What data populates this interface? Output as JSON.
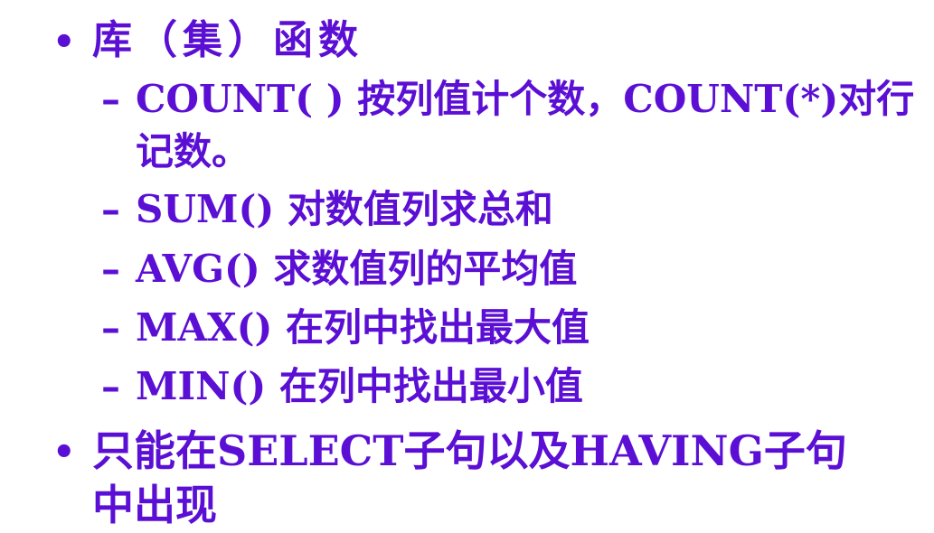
{
  "slide": {
    "items": [
      {
        "marker": "•",
        "text": "库（集）函数",
        "subitems": [
          {
            "marker": "–",
            "text": "COUNT( ) 按列值计个数，COUNT(*)对行",
            "continuation": "记数。"
          },
          {
            "marker": "–",
            "text": "SUM() 对数值列求总和"
          },
          {
            "marker": "–",
            "text": "AVG() 求数值列的平均值"
          },
          {
            "marker": "–",
            "text": "MAX() 在列中找出最大值"
          },
          {
            "marker": "–",
            "text": "MIN()  在列中找出最小值"
          }
        ]
      },
      {
        "marker": "•",
        "text": "只能在SELECT子句以及HAVING子句",
        "continuation": "中出现"
      }
    ]
  },
  "colors": {
    "text": "#5b0fd4",
    "background": "#ffffff"
  }
}
